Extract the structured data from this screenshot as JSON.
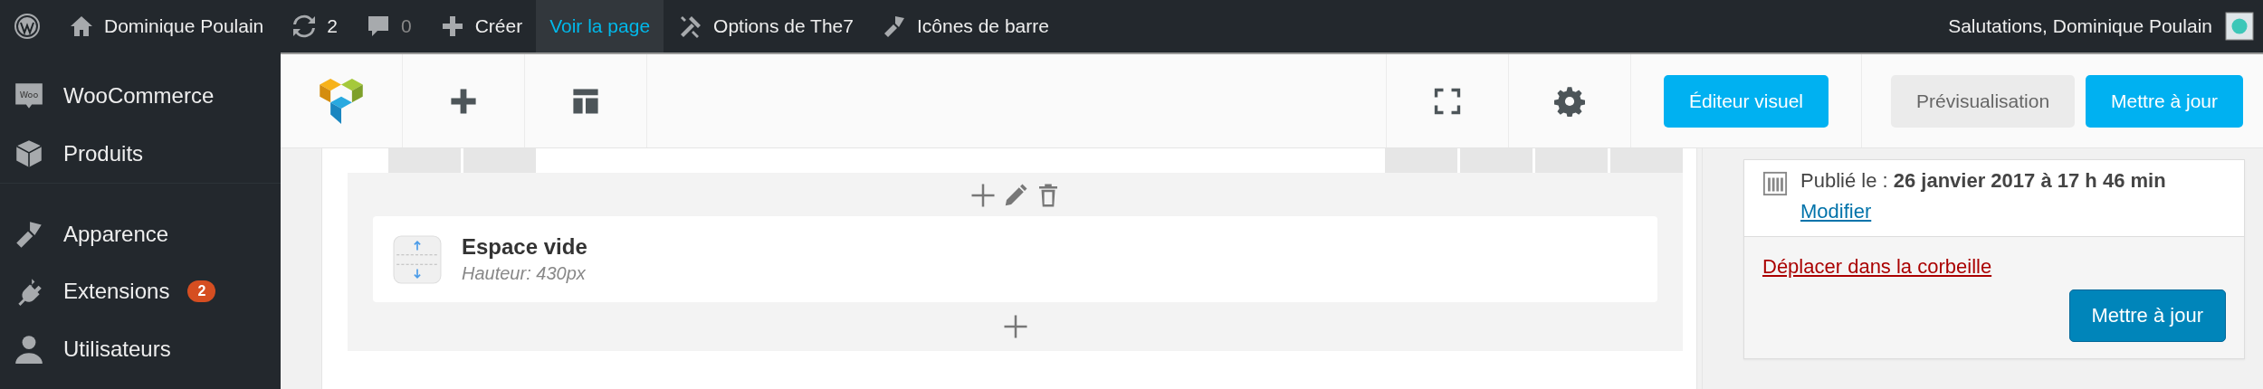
{
  "admin_bar": {
    "items": [
      {
        "kind": "wp-logo",
        "selected": false
      },
      {
        "kind": "home",
        "label": "Dominique Poulain",
        "selected": false
      },
      {
        "kind": "updates",
        "label": "2",
        "selected": false
      },
      {
        "kind": "comments",
        "label": "0",
        "selected": false
      },
      {
        "kind": "new",
        "label": "Créer",
        "selected": false
      },
      {
        "kind": "link",
        "label": "Voir la page",
        "selected": true
      },
      {
        "kind": "tools",
        "label": "Options de The7",
        "selected": false
      },
      {
        "kind": "brush",
        "label": "Icônes de barre",
        "selected": false
      }
    ],
    "greeting": "Salutations, Dominique Poulain"
  },
  "sidebar": {
    "items": [
      {
        "kind": "woo",
        "label": "WooCommerce",
        "icon_text": "Woo",
        "gap": false
      },
      {
        "kind": "box",
        "label": "Produits",
        "gap": false
      },
      {
        "kind": "brush",
        "label": "Apparence",
        "gap": true
      },
      {
        "kind": "plug",
        "label": "Extensions",
        "badge": "2",
        "gap": false
      },
      {
        "kind": "user",
        "label": "Utilisateurs",
        "gap": false
      }
    ]
  },
  "builder_toolbar": {
    "left_tools": [
      {
        "kind": "logo"
      },
      {
        "kind": "add"
      },
      {
        "kind": "layout"
      }
    ],
    "right_tools": [
      {
        "kind": "fullscreen"
      },
      {
        "kind": "settings"
      }
    ],
    "buttons": [
      {
        "label": "Éditeur visuel",
        "kind": "primary"
      },
      {
        "label": "Prévisualisation",
        "kind": "secondary"
      },
      {
        "label": "Mettre à jour",
        "kind": "primary"
      }
    ]
  },
  "element": {
    "title": "Espace vide",
    "subtitle": "Hauteur: 430px"
  },
  "publish_box": {
    "published": "Publié le : **26 janvier 2017 à 17 h 46 min**",
    "edit_link": "Modifier",
    "trash_link": "Déplacer dans la corbeille",
    "update_button": "Mettre à jour"
  }
}
